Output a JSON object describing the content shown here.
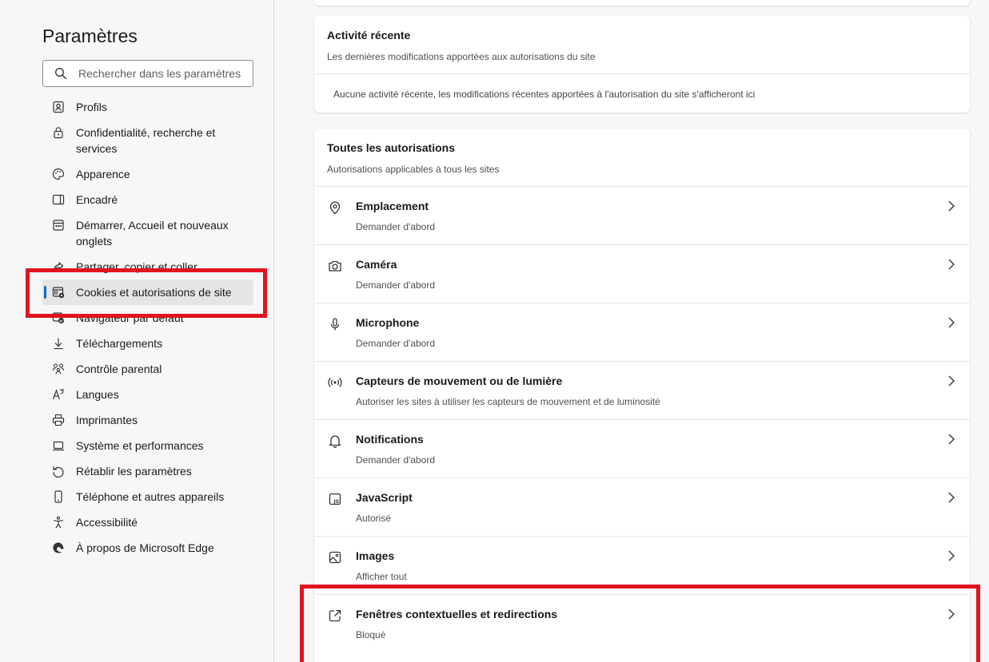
{
  "sidebar": {
    "title": "Paramètres",
    "search_placeholder": "Rechercher dans les paramètres",
    "items": [
      {
        "label": "Profils",
        "icon": "profile-icon"
      },
      {
        "label": "Confidentialité, recherche et services",
        "icon": "lock-icon"
      },
      {
        "label": "Apparence",
        "icon": "palette-icon"
      },
      {
        "label": "Encadré",
        "icon": "sidebar-icon"
      },
      {
        "label": "Démarrer, Accueil et nouveaux onglets",
        "icon": "home-tabs-icon"
      },
      {
        "label": "Partager, copier et coller",
        "icon": "share-icon"
      },
      {
        "label": "Cookies et autorisations de site",
        "icon": "cookies-icon"
      },
      {
        "label": "Navigateur par défaut",
        "icon": "default-browser-icon"
      },
      {
        "label": "Téléchargements",
        "icon": "download-icon"
      },
      {
        "label": "Contrôle parental",
        "icon": "family-icon"
      },
      {
        "label": "Langues",
        "icon": "language-icon"
      },
      {
        "label": "Imprimantes",
        "icon": "printer-icon"
      },
      {
        "label": "Système et performances",
        "icon": "laptop-icon"
      },
      {
        "label": "Rétablir les paramètres",
        "icon": "reset-icon"
      },
      {
        "label": "Téléphone et autres appareils",
        "icon": "phone-icon"
      },
      {
        "label": "Accessibilité",
        "icon": "accessibility-icon"
      },
      {
        "label": "À propos de Microsoft Edge",
        "icon": "edge-icon"
      }
    ],
    "active_index": 6
  },
  "recent": {
    "title": "Activité récente",
    "subtitle": "Les dernières modifications apportées aux autorisations du site",
    "empty": "Aucune activité récente, les modifications récentes apportées à l'autorisation du site s'afficheront ici"
  },
  "all_permissions": {
    "title": "Toutes les autorisations",
    "subtitle": "Autorisations applicables à tous les sites",
    "items": [
      {
        "title": "Emplacement",
        "status": "Demander d'abord",
        "icon": "location-icon"
      },
      {
        "title": "Caméra",
        "status": "Demander d'abord",
        "icon": "camera-icon"
      },
      {
        "title": "Microphone",
        "status": "Demander d'abord",
        "icon": "microphone-icon"
      },
      {
        "title": "Capteurs de mouvement ou de lumière",
        "status": "Autoriser les sites à utiliser les capteurs de mouvement et de luminosité",
        "icon": "sensors-icon"
      },
      {
        "title": "Notifications",
        "status": "Demander d'abord",
        "icon": "bell-icon"
      },
      {
        "title": "JavaScript",
        "status": "Autorisé",
        "icon": "javascript-icon"
      },
      {
        "title": "Images",
        "status": "Afficher tout",
        "icon": "image-icon"
      },
      {
        "title": "Fenêtres contextuelles et redirections",
        "status": "Bloqué",
        "icon": "popup-icon"
      }
    ]
  },
  "colors": {
    "accent": "#0f6cbd",
    "highlight": "#e0141e"
  }
}
